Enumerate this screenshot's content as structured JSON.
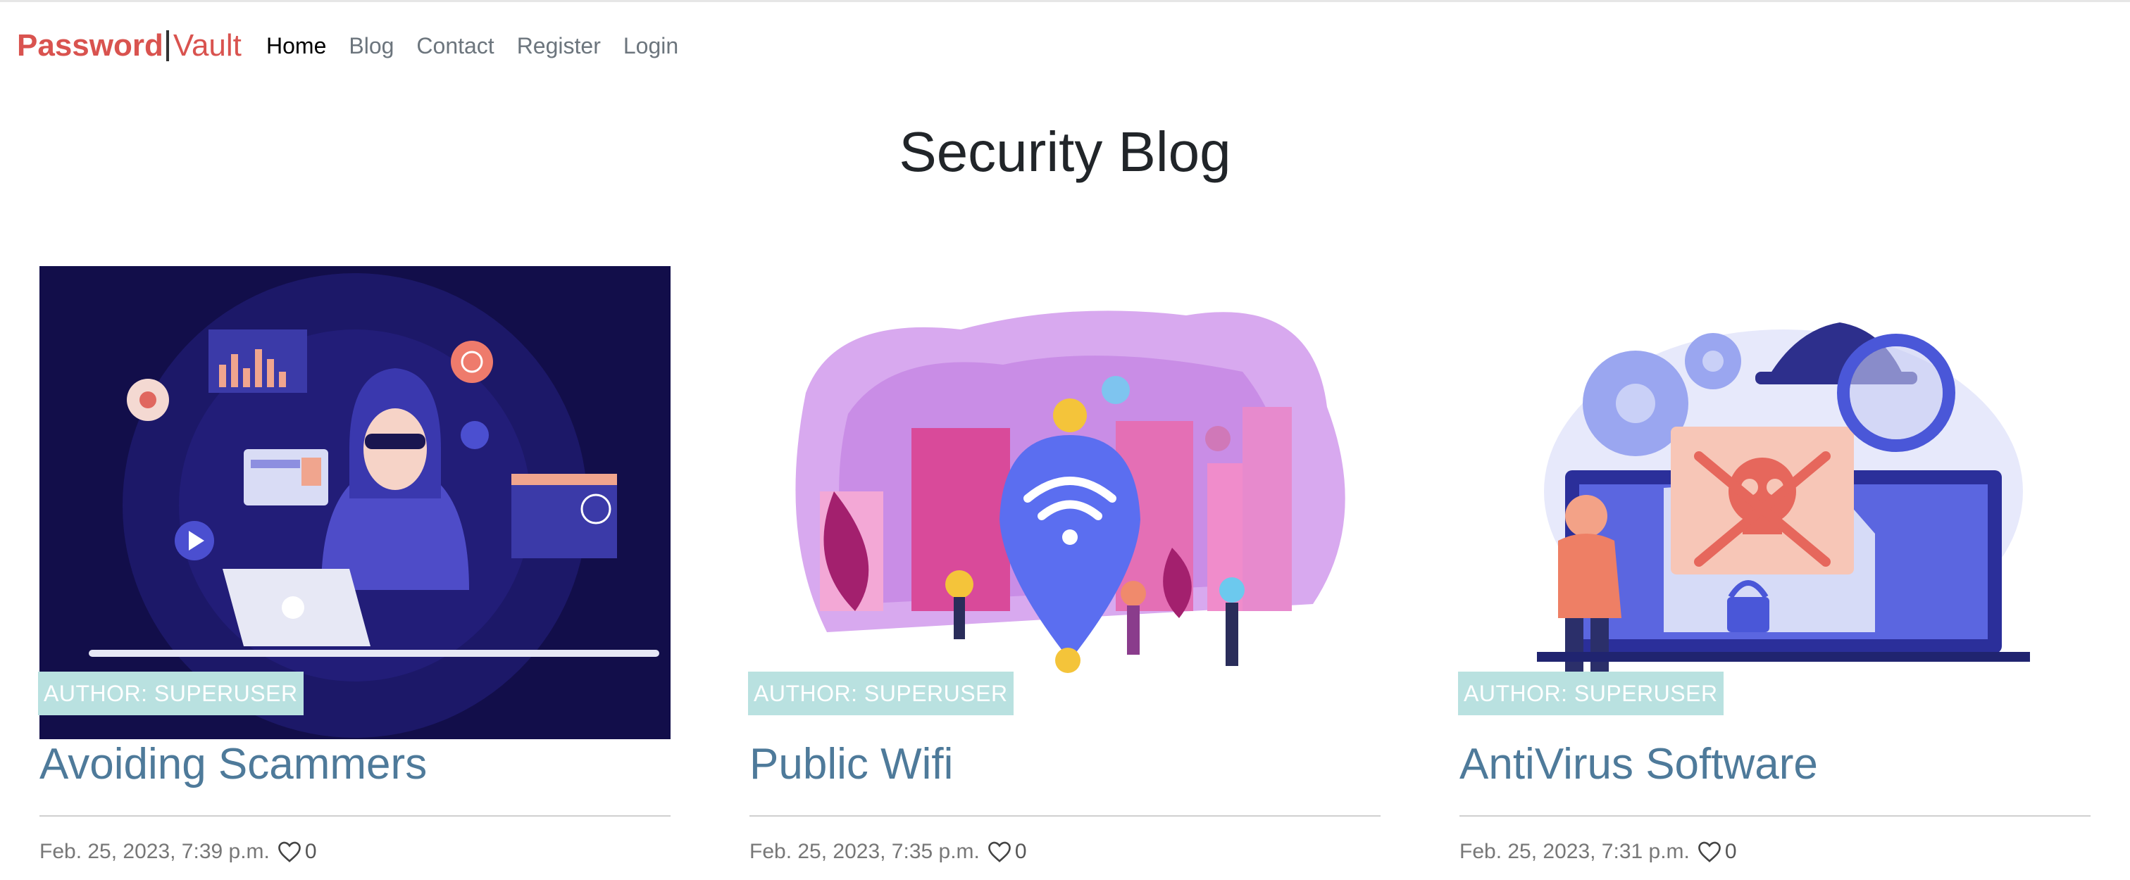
{
  "brand": {
    "part1": "Password",
    "part2": "Vault"
  },
  "nav": [
    {
      "label": "Home",
      "active": true
    },
    {
      "label": "Blog",
      "active": false
    },
    {
      "label": "Contact",
      "active": false
    },
    {
      "label": "Register",
      "active": false
    },
    {
      "label": "Login",
      "active": false
    }
  ],
  "page": {
    "title": "Security Blog"
  },
  "posts": [
    {
      "author": "AUTHOR: SUPERUSER",
      "title": "Avoiding Scammers",
      "date": "Feb. 25, 2023, 7:39 p.m.",
      "likes": "0",
      "image_icon": "hacker-illustration"
    },
    {
      "author": "AUTHOR: SUPERUSER",
      "title": "Public Wifi",
      "date": "Feb. 25, 2023, 7:35 p.m.",
      "likes": "0",
      "image_icon": "wifi-illustration"
    },
    {
      "author": "AUTHOR: SUPERUSER",
      "title": "AntiVirus Software",
      "date": "Feb. 25, 2023, 7:31 p.m.",
      "likes": "0",
      "image_icon": "spy-virus-illustration"
    }
  ],
  "colors": {
    "brand": "#d9534f",
    "post_title": "#4e7a9a",
    "author_badge": "#b9e1e0"
  }
}
